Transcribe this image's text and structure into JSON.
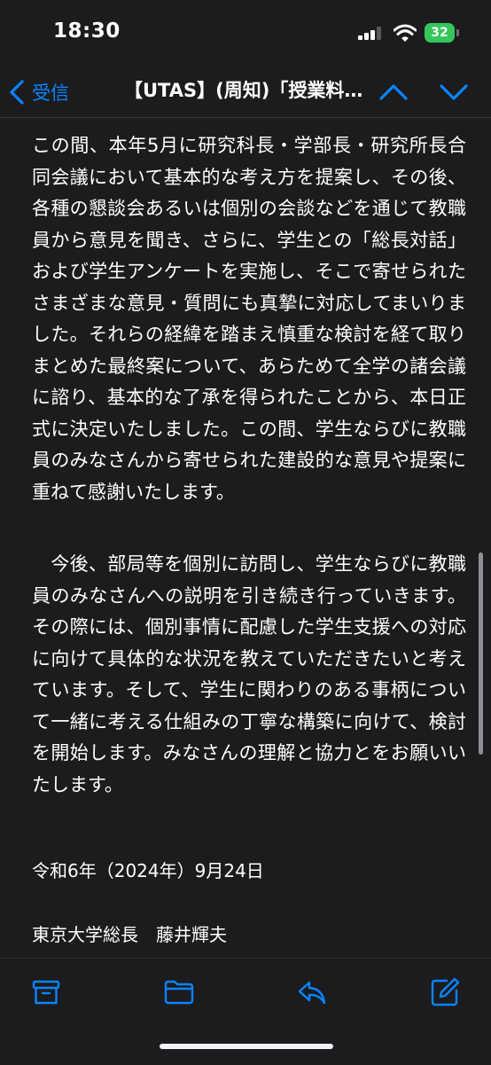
{
  "status": {
    "time": "18:30",
    "battery": "32"
  },
  "nav": {
    "back_label": "受信",
    "title": "【UTAS】(周知)「授業料…"
  },
  "message": {
    "paragraph1": "この間、本年5月に研究科長・学部長・研究所長合同会議において基本的な考え方を提案し、その後、各種の懇談会あるいは個別の会談などを通じて教職員から意見を聞き、さらに、学生との「総長対話」および学生アンケートを実施し、そこで寄せられたさまざまな意見・質問にも真摯に対応してまいりました。それらの経緯を踏まえ慎重な検討を経て取りまとめた最終案について、あらためて全学の諸会議に諮り、基本的な了承を得られたことから、本日正式に決定いたしました。この間、学生ならびに教職員のみなさんから寄せられた建設的な意見や提案に重ねて感謝いたします。",
    "paragraph2": "　今後、部局等を個別に訪問し、学生ならびに教職員のみなさんへの説明を引き続き行っていきます。その際には、個別事情に配慮した学生支援への対応に向けて具体的な状況を教えていただきたいと考えています。そして、学生に関わりのある事柄について一緒に考える仕組みの丁寧な構築に向けて、検討を開始します。みなさんの理解と協力とをお願いいたします。",
    "date": "令和6年（2024年）9月24日",
    "signature": "東京大学総長　藤井輝夫"
  },
  "colors": {
    "accent": "#0a84ff",
    "background": "#1c1c1e",
    "text": "#ffffff",
    "battery": "#34c759"
  },
  "icons": {
    "back": "chevron-left-icon",
    "prev": "chevron-up-icon",
    "next": "chevron-down-icon",
    "archive": "archive-icon",
    "folder": "folder-icon",
    "reply": "reply-icon",
    "compose": "compose-icon"
  }
}
